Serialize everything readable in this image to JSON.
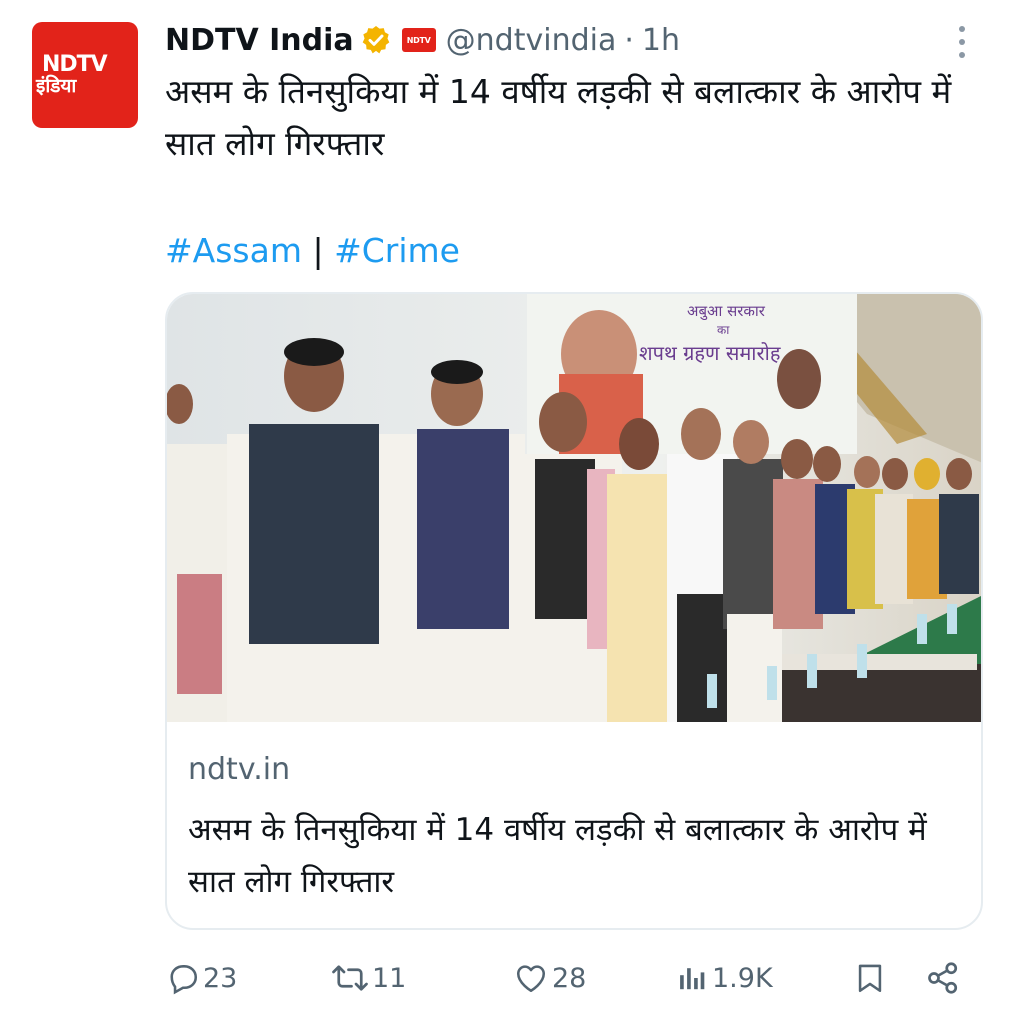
{
  "tweet": {
    "display_name": "NDTV India",
    "handle": "@ndtvindia",
    "separator": "·",
    "time": "1h",
    "avatar_top": "NDTV",
    "avatar_bottom": "इंडिया",
    "affiliate_badge": "NDTV",
    "text": "असम के तिनसुकिया में 14 वर्षीय लड़की से बलात्कार के आरोप में सात लोग गिरफ्तार",
    "hashtags": [
      "#Assam",
      "#Crime"
    ],
    "hashtag_separator": "|"
  },
  "card": {
    "banner_line1": "अबुआ सरकार",
    "banner_line2": "का",
    "banner_line3": "शपथ ग्रहण समारोह",
    "domain": "ndtv.in",
    "title": "असम के तिनसुकिया में 14 वर्षीय लड़की से बलात्कार के आरोप में सात लोग गिरफ्तार"
  },
  "actions": {
    "replies": "23",
    "reposts": "11",
    "likes": "28",
    "views": "1.9K"
  },
  "icons": [
    "verified-badge-icon",
    "more-icon",
    "reply-icon",
    "repost-icon",
    "like-icon",
    "views-icon",
    "bookmark-icon",
    "share-icon"
  ],
  "colors": {
    "link": "#1d9bf0",
    "brand": "#e2231a",
    "muted": "#536471",
    "verified": "#f4b400"
  }
}
